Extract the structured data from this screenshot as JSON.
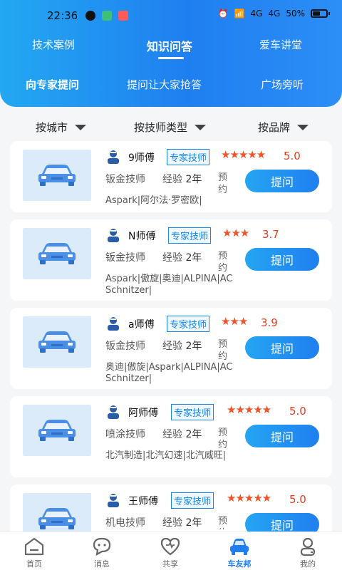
{
  "status_bar": {
    "time": "22:36",
    "battery": "50%",
    "signal1": "4G",
    "signal2": "4G"
  },
  "top_tabs": [
    {
      "label": "技术案例",
      "active": false
    },
    {
      "label": "知识问答",
      "active": true
    },
    {
      "label": "爱车讲堂",
      "active": false
    }
  ],
  "sub_tabs": [
    {
      "label": "向专家提问",
      "active": true
    },
    {
      "label": "提问让大家抢答",
      "active": false
    },
    {
      "label": "广场旁听",
      "active": false
    }
  ],
  "filters": [
    {
      "label": "按城市"
    },
    {
      "label": "按技师类型"
    },
    {
      "label": "按品牌"
    }
  ],
  "technicians": [
    {
      "name": "9师傅",
      "badge": "专家技师",
      "stars": "★★★★★",
      "score": "5.0",
      "role": "钣金技师",
      "exp_label": "经验",
      "exp_value": "2年",
      "appointment": "预约",
      "ask": "提问",
      "brands": "Aspark|阿尔法·罗密欧|"
    },
    {
      "name": "N师傅",
      "badge": "专家技师",
      "stars": "★★★",
      "score": "3.7",
      "role": "钣金技师",
      "exp_label": "经验",
      "exp_value": "2年",
      "appointment": "预约",
      "ask": "提问",
      "brands": "Aspark|傲旋|奥迪|ALPINA|AC Schnitzer|"
    },
    {
      "name": "a师傅",
      "badge": "专家技师",
      "stars": "★★★",
      "score": "3.9",
      "role": "钣金技师",
      "exp_label": "经验",
      "exp_value": "2年",
      "appointment": "预约",
      "ask": "提问",
      "brands": "奥迪|傲旋|Aspark|ALPINA|AC Schnitzer|"
    },
    {
      "name": "阿师傅",
      "badge": "专家技师",
      "stars": "★★★★★",
      "score": "5.0",
      "role": "喷涂技师",
      "exp_label": "经验",
      "exp_value": "2年",
      "appointment": "预约",
      "ask": "提问",
      "brands": "北汽制造|北汽幻速|北汽威旺|"
    },
    {
      "name": "王师傅",
      "badge": "专家技师",
      "stars": "★★★★★",
      "score": "5.0",
      "role": "机电技师",
      "exp_label": "经验",
      "exp_value": "2年",
      "appointment": "预约",
      "ask": "提问",
      "brands": ""
    }
  ],
  "bottom_nav": [
    {
      "label": "首页",
      "icon": "home-icon",
      "active": false
    },
    {
      "label": "消息",
      "icon": "message-icon",
      "active": false
    },
    {
      "label": "共享",
      "icon": "share-heart-icon",
      "active": false
    },
    {
      "label": "车友邦",
      "icon": "car-club-icon",
      "active": true
    },
    {
      "label": "我的",
      "icon": "profile-icon",
      "active": false
    }
  ],
  "colors": {
    "accent": "#1f7ff0",
    "star": "#f0522a",
    "score": "#e63b1f",
    "thumb_bg": "#dcebfa"
  }
}
